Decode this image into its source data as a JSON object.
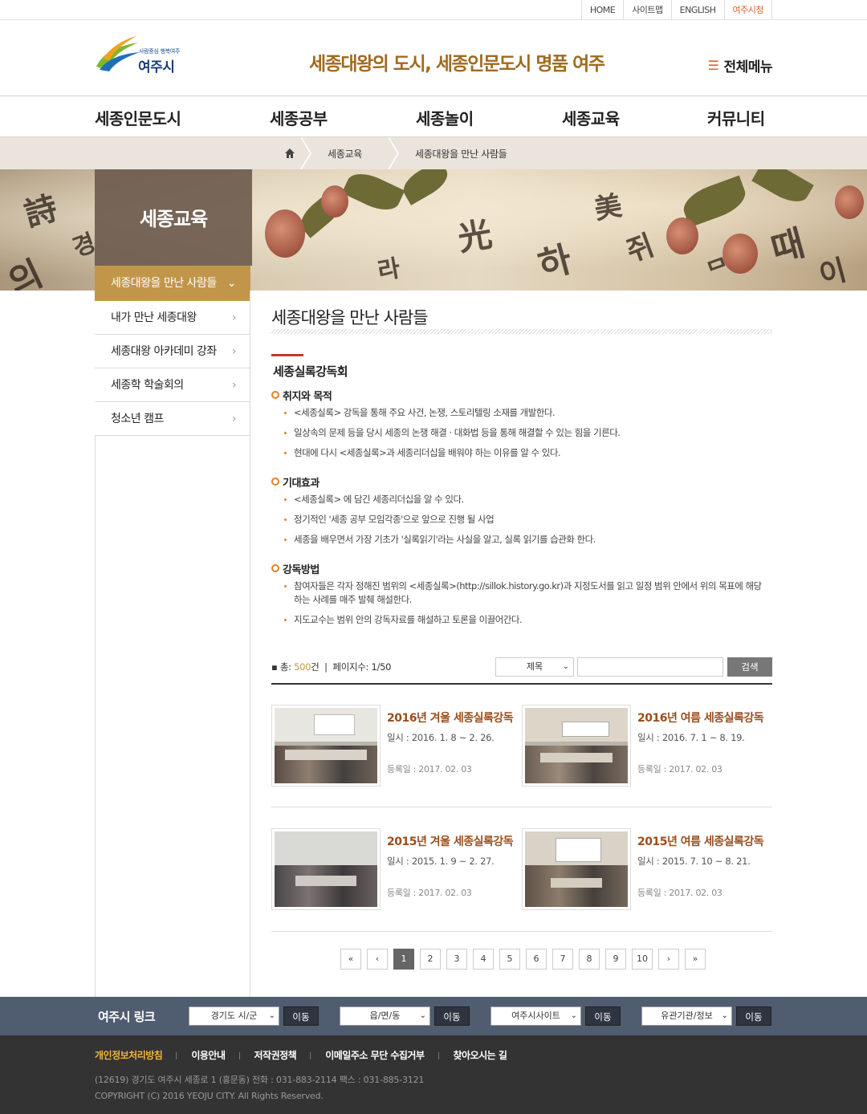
{
  "util_links": [
    "HOME",
    "사이트맵",
    "ENGLISH",
    "여주시청"
  ],
  "logo": {
    "slogan": "사람중심 행복여주",
    "city": "여주시"
  },
  "tagline": "세종대왕의 도시, 세종인문도시 명품 여주",
  "all_menu": "전체메뉴",
  "gnb": [
    "세종인문도시",
    "세종공부",
    "세종놀이",
    "세종교육",
    "커뮤니티"
  ],
  "breadcrumb": [
    "세종교육",
    "세종대왕을 만난 사람들"
  ],
  "lnb": {
    "title": "세종교육",
    "items": [
      "세종대왕을 만난 사람들",
      "내가 만난 세종대왕",
      "세종대왕 아카데미 강좌",
      "세종학 학술회의",
      "청소년 캠프"
    ]
  },
  "page_title": "세종대왕을 만난 사람들",
  "section_title": "세종실록강독회",
  "subsections": [
    {
      "title": "취지와 목적",
      "items": [
        "<세종실록> 강독을 통해 주요 사건, 논쟁, 스토리텔링 소재를 개발한다.",
        "일상속의 문제 등을 당시 세종의 논쟁 해결 · 대화법 등을 통해 해결할 수 있는 힘을 기른다.",
        "현대에 다시 <세종실록>과 세종리더십을 배워야 하는 이유를 알 수 있다."
      ]
    },
    {
      "title": "기대효과",
      "items": [
        "<세종실록> 에 담긴 세종리더십을 알 수 있다.",
        "정기적인 '세종 공부 모임각종'으로 앞으로 진행 될 사업",
        "세종을 배우면서 가장 기초가 '실록읽기'라는 사실을 알고, 실록 읽기를 습관화 한다."
      ]
    },
    {
      "title": "강독방법",
      "items": [
        "참여자들은 각자 정해진 범위의 <세종실록>(http://sillok.history.go.kr)과 지정도서를 읽고 일정 범위 안에서 위의 목표에 해당하는 사례를 매주 발췌 해설한다.",
        "지도교수는 범위 안의 강독자료를 해설하고 토론을 이끌어간다."
      ]
    }
  ],
  "board": {
    "total_label": "총: ",
    "total_value": "500",
    "total_unit": "건",
    "page_label": "페이지수: 1/50",
    "search_select": "제목",
    "search_value": "",
    "search_button": "검색"
  },
  "posts": [
    {
      "title": "2016년 겨울 세종실록강독",
      "date": "일시 : 2016. 1. 8 ~ 2. 26.",
      "reg": "등록일 : 2017. 02. 03"
    },
    {
      "title": "2016년 여름 세종실록강독",
      "date": "일시 : 2016. 7. 1 ~ 8. 19.",
      "reg": "등록일 : 2017. 02. 03"
    },
    {
      "title": "2015년 겨울 세종실록강독",
      "date": "일시 : 2015. 1. 9 ~ 2. 27.",
      "reg": "등록일 : 2017. 02. 03"
    },
    {
      "title": "2015년 여름 세종실록강독",
      "date": "일시 : 2015. 7. 10 ~ 8. 21.",
      "reg": "등록일 : 2017. 02. 03"
    }
  ],
  "pagination": {
    "first": "«",
    "prev": "‹",
    "pages": [
      "1",
      "2",
      "3",
      "4",
      "5",
      "6",
      "7",
      "8",
      "9",
      "10"
    ],
    "current": "1",
    "next": "›",
    "last": "»"
  },
  "linkbar": {
    "title": "여주시 링크",
    "selects": [
      "경기도 시/군",
      "읍/면/동",
      "여주시사이트",
      "유관기관/정보"
    ],
    "go": "이동"
  },
  "footer": {
    "links": [
      "개인정보처리방침",
      "이용안내",
      "저작권정책",
      "이메일주소 무단 수집거부",
      "찾아오시는 길"
    ],
    "address": "(12619) 경기도 여주시 세종로 1 (홍문동)  전화 : 031-883-2114  팩스 : 031-885-3121",
    "copyright": "COPYRIGHT (C) 2016 YEOJU CITY. All Rights Reserved."
  },
  "colors": {
    "accent": "#c2964a",
    "orange": "#e0602a",
    "title_brown": "#9a4e1d",
    "linkbar": "#505d70",
    "footer": "#333333"
  }
}
